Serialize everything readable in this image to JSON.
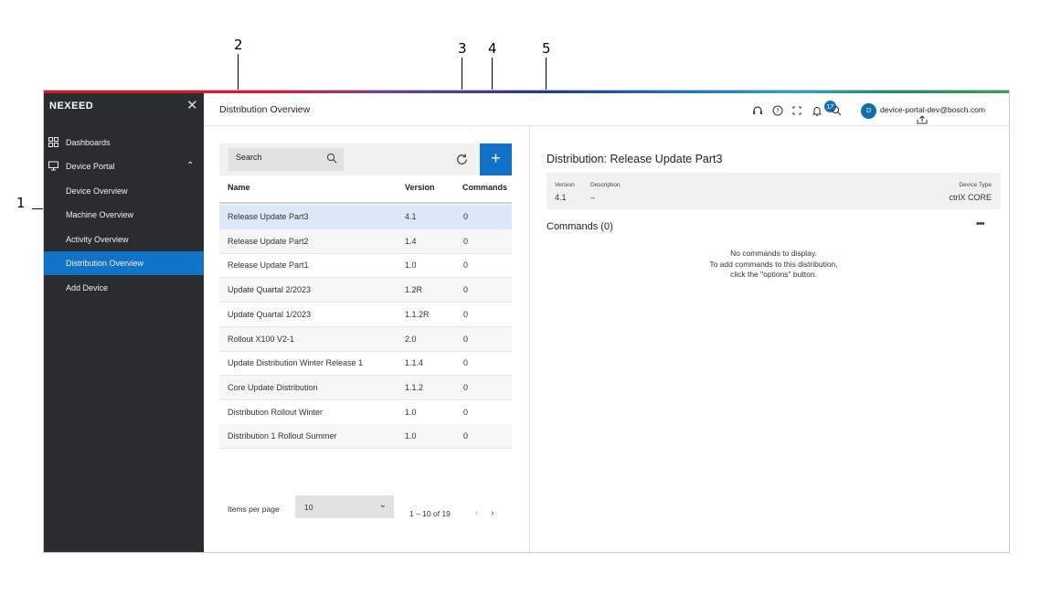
{
  "callouts": [
    "1",
    "2",
    "3",
    "4",
    "5"
  ],
  "sidebar": {
    "brand": "NEXEED",
    "items": [
      {
        "label": "Dashboards",
        "icon": "grid-icon"
      },
      {
        "label": "Device Portal",
        "icon": "device-portal-icon"
      },
      {
        "label": "Device Overview"
      },
      {
        "label": "Machine Overview"
      },
      {
        "label": "Activity Overview"
      },
      {
        "label": "Distribution Overview",
        "active": true
      },
      {
        "label": "Add Device"
      }
    ]
  },
  "header": {
    "title": "Distribution Overview",
    "notification_count": "13",
    "avatar_initial": "D",
    "user_email": "device-portal-dev@bosch.com",
    "icons": [
      "headset-icon",
      "help-icon",
      "fullscreen-icon",
      "bell-icon",
      "search-icon",
      "upload-icon"
    ]
  },
  "list": {
    "search_placeholder": "Search",
    "columns": [
      "Name",
      "Version",
      "Commands"
    ],
    "rows": [
      {
        "name": "Release Update Part3",
        "version": "4.1",
        "commands": "0"
      },
      {
        "name": "Release Update Part2",
        "version": "1.4",
        "commands": "0"
      },
      {
        "name": "Release Update Part1",
        "version": "1.0",
        "commands": "0"
      },
      {
        "name": "Update Quartal 2/2023",
        "version": "1.2R",
        "commands": "0"
      },
      {
        "name": "Update Quartal 1/2023",
        "version": "1.1.2R",
        "commands": "0"
      },
      {
        "name": "Rollout X100 V2-1",
        "version": "2.0",
        "commands": "0"
      },
      {
        "name": "Update Distribution Winter Release 1",
        "version": "1.1.4",
        "commands": "0"
      },
      {
        "name": "Core Update Distribution",
        "version": "1.1.2",
        "commands": "0"
      },
      {
        "name": "Distribution Rollout Winter",
        "version": "1.0",
        "commands": "0"
      },
      {
        "name": "Distribution 1 Rollout Summer",
        "version": "1.0",
        "commands": "0"
      }
    ],
    "items_per_page_label": "Items per page",
    "items_per_page": "10",
    "range": "1 – 10 of 19"
  },
  "detail": {
    "title": "Distribution: Release Update Part3",
    "version_label": "Version",
    "version": "4.1",
    "description_label": "Description",
    "description": "–",
    "device_type_label": "Device Type",
    "device_type": "ctrlX CORE",
    "commands_title": "Commands (0)",
    "more": "•••",
    "empty_line1": "No commands to display.",
    "empty_line2": "To add commands to this distribution,",
    "empty_line3": "click the \"options\" button."
  }
}
